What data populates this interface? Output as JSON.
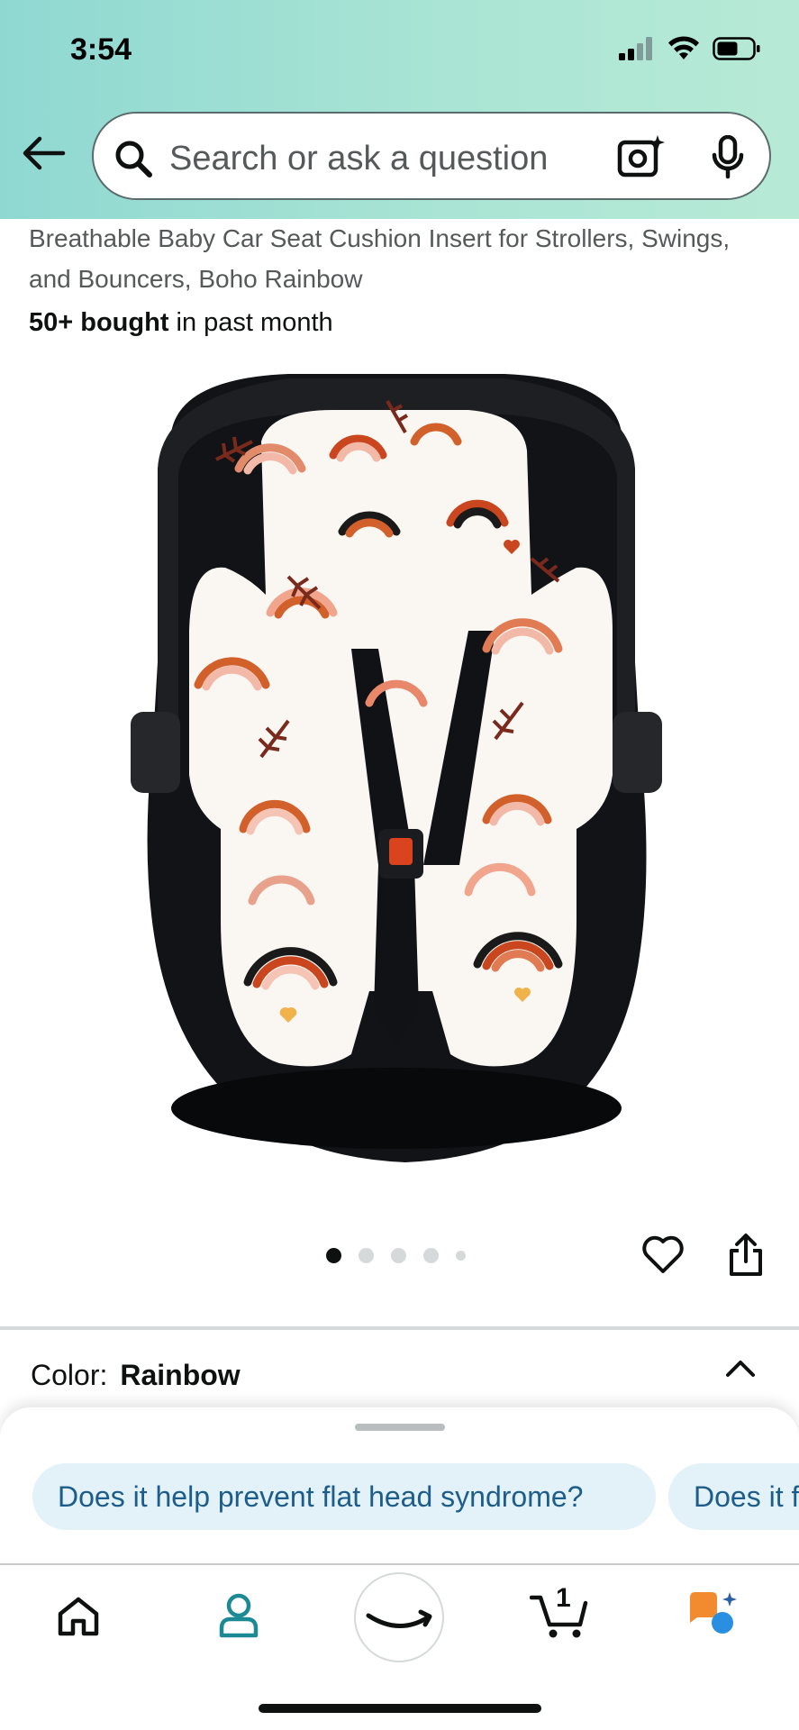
{
  "status_bar": {
    "time": "3:54"
  },
  "search": {
    "placeholder": "Search or ask a question"
  },
  "product": {
    "title_line1": "Breathable Baby Car Seat Cushion Insert for Strollers, Swings,",
    "title_line2": "and Bouncers, Boho Rainbow",
    "bought_bold": "50+ bought",
    "bought_rest": "in past month",
    "image_count": 5,
    "active_image_index": 1
  },
  "variant": {
    "label": "Color:",
    "value": "Rainbow"
  },
  "suggestions": [
    "Does it help prevent flat head syndrome?",
    "Does it f"
  ],
  "cart": {
    "count": "1"
  },
  "colors": {
    "header_gradient_start": "#8fd8d2",
    "header_gradient_end": "#b7ead6",
    "chip_background": "#e3f1f8",
    "chip_text": "#1c5d8b",
    "account_icon": "#1c8a95",
    "rufus_orange": "#f28b30",
    "rufus_blue": "#2a8fe0"
  },
  "icons": [
    "back-arrow-icon",
    "search-icon",
    "camera-icon",
    "mic-icon",
    "heart-icon",
    "share-icon",
    "chevron-up-icon",
    "home-icon",
    "account-icon",
    "amazon-smile-icon",
    "cart-icon",
    "rufus-icon"
  ]
}
